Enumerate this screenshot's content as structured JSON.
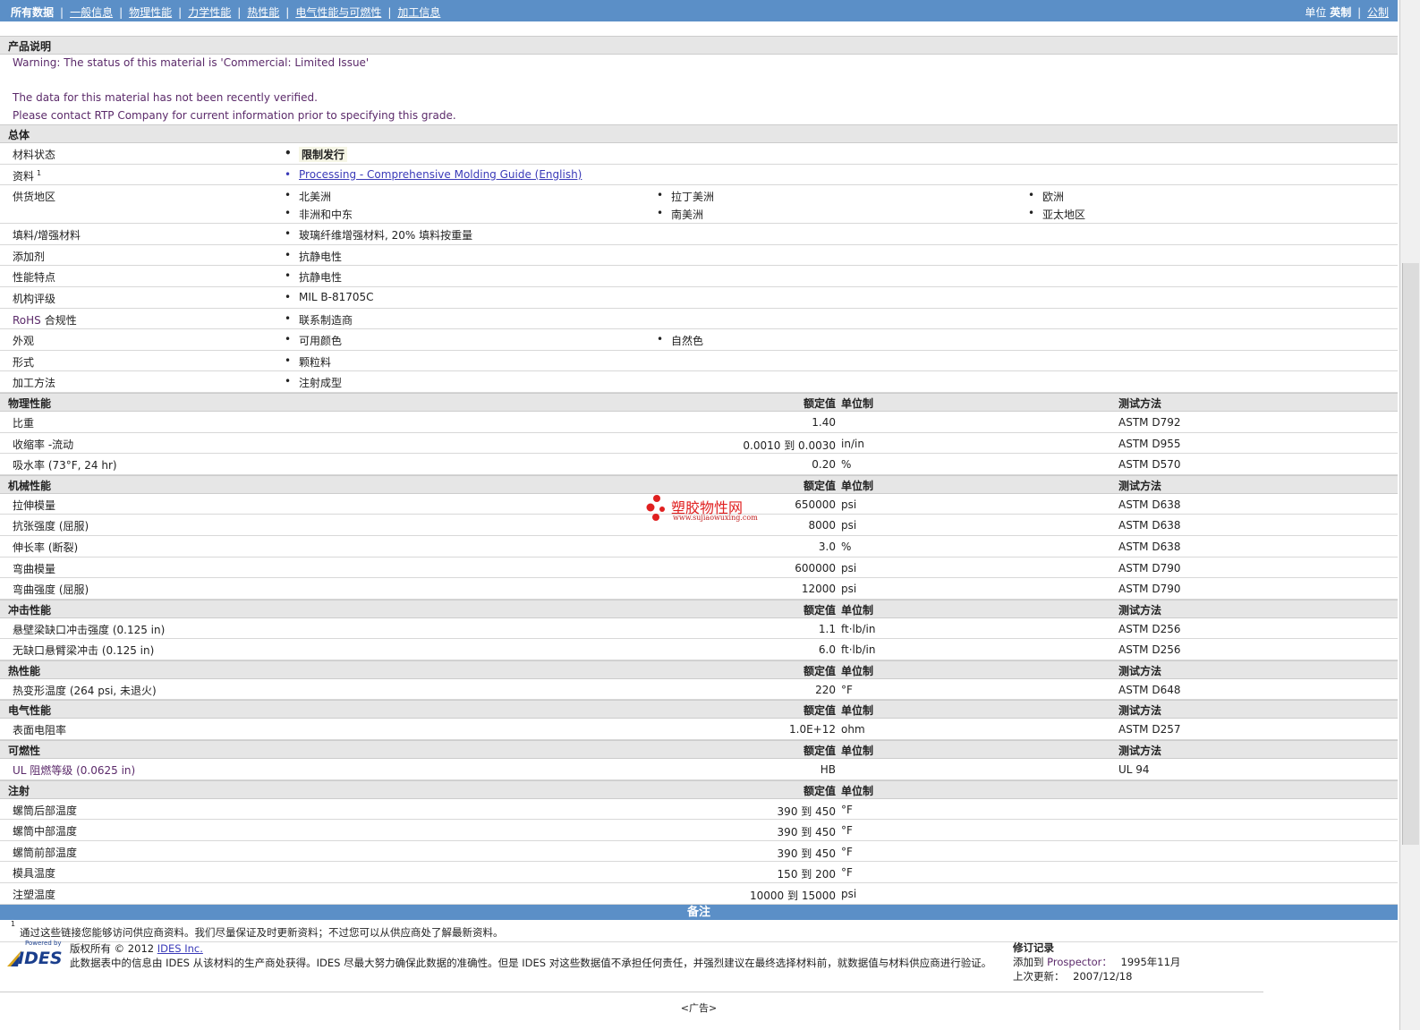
{
  "nav": {
    "items": [
      "所有数据",
      "一般信息",
      "物理性能",
      "力学性能",
      "热性能",
      "电气性能与可燃性",
      "加工信息"
    ],
    "sep": "|"
  },
  "units": {
    "label": "单位",
    "english": "英制",
    "sep": "|",
    "metric": "公制"
  },
  "product": {
    "title": "产品说明",
    "lines": [
      "Warning: The status of this material is 'Commercial: Limited Issue'",
      "",
      "The data for this material has not been recently verified.",
      "Please contact RTP Company for current information prior to specifying this grade."
    ]
  },
  "general": {
    "title": "总体",
    "rows": [
      {
        "label": "材料状态",
        "items": [
          "限制发行"
        ]
      },
      {
        "label": "资料",
        "sup": "1",
        "items": [
          "Processing - Comprehensive Molding Guide (English)"
        ]
      },
      {
        "label": "供货地区",
        "items": [
          "北美洲",
          "拉丁美洲",
          "欧洲",
          "非洲和中东",
          "南美洲",
          "亚太地区"
        ]
      },
      {
        "label": "填料/增强材料",
        "items": [
          "玻璃纤维增强材料, 20% 填料按重量"
        ]
      },
      {
        "label": "添加剂",
        "items": [
          "抗静电性"
        ]
      },
      {
        "label": "性能特点",
        "items": [
          "抗静电性"
        ]
      },
      {
        "label": "机构评级",
        "items": [
          "MIL B-81705C"
        ]
      },
      {
        "label_a": "RoHS",
        "label_b": "合规性",
        "items": [
          "联系制造商"
        ]
      },
      {
        "label": "外观",
        "items": [
          "可用颜色",
          "自然色"
        ]
      },
      {
        "label": "形式",
        "items": [
          "颗粒料"
        ]
      },
      {
        "label": "加工方法",
        "items": [
          "注射成型"
        ]
      }
    ]
  },
  "col_headers": {
    "value": "额定值",
    "unit": "单位制",
    "method": "测试方法"
  },
  "sections": [
    {
      "title": "物理性能",
      "has_method": true,
      "rows": [
        {
          "label": "比重",
          "value": "1.40",
          "unit": "",
          "method": "ASTM D792"
        },
        {
          "label": "收缩率 -流动",
          "value": "0.0010 到 0.0030",
          "unit": "in/in",
          "method": "ASTM D955"
        },
        {
          "label": "吸水率 (73°F, 24 hr)",
          "value": "0.20",
          "unit": "%",
          "method": "ASTM D570"
        }
      ]
    },
    {
      "title": "机械性能",
      "has_method": true,
      "rows": [
        {
          "label": "拉伸模量",
          "value": "650000",
          "unit": "psi",
          "method": "ASTM D638"
        },
        {
          "label": "抗张强度 (屈服)",
          "value": "8000",
          "unit": "psi",
          "method": "ASTM D638"
        },
        {
          "label": "伸长率 (断裂)",
          "value": "3.0",
          "unit": "%",
          "method": "ASTM D638"
        },
        {
          "label": "弯曲模量",
          "value": "600000",
          "unit": "psi",
          "method": "ASTM D790"
        },
        {
          "label": "弯曲强度 (屈服)",
          "value": "12000",
          "unit": "psi",
          "method": "ASTM D790"
        }
      ]
    },
    {
      "title": "冲击性能",
      "has_method": true,
      "rows": [
        {
          "label": "悬壁梁缺口冲击强度 (0.125 in)",
          "value": "1.1",
          "unit": "ft·lb/in",
          "method": "ASTM D256"
        },
        {
          "label": "无缺口悬臂梁冲击 (0.125 in)",
          "value": "6.0",
          "unit": "ft·lb/in",
          "method": "ASTM D256"
        }
      ]
    },
    {
      "title": "热性能",
      "has_method": true,
      "rows": [
        {
          "label": "热变形温度 (264 psi, 未退火)",
          "value": "220",
          "unit": "°F",
          "method": "ASTM D648"
        }
      ]
    },
    {
      "title": "电气性能",
      "has_method": true,
      "rows": [
        {
          "label": "表面电阻率",
          "value": "1.0E+12",
          "unit": "ohm",
          "method": "ASTM D257"
        }
      ]
    },
    {
      "title": "可燃性",
      "has_method": true,
      "rows": [
        {
          "label": "UL 阻燃等级 (0.0625 in)",
          "value": "HB",
          "unit": "",
          "method": "UL 94"
        }
      ]
    },
    {
      "title": "注射",
      "has_method": false,
      "rows": [
        {
          "label": "螺筒后部温度",
          "value": "390 到 450",
          "unit": "°F",
          "method": ""
        },
        {
          "label": "螺筒中部温度",
          "value": "390 到 450",
          "unit": "°F",
          "method": ""
        },
        {
          "label": "螺筒前部温度",
          "value": "390 到 450",
          "unit": "°F",
          "method": ""
        },
        {
          "label": "模具温度",
          "value": "150 到 200",
          "unit": "°F",
          "method": ""
        },
        {
          "label": "注塑温度",
          "value": "10000 到 15000",
          "unit": "psi",
          "method": ""
        }
      ]
    }
  ],
  "watermark": {
    "main": "塑胶物性网",
    "sub": "www.sujiaowuxing.com"
  },
  "notes": {
    "title": "备注",
    "sup": "1",
    "text": "通过这些链接您能够访问供应商资料。我们尽量保证及时更新资料；不过您可以从供应商处了解最新资料。"
  },
  "footer": {
    "powered": "Powered by",
    "logo": "IDES",
    "copyright": "版权所有 © 2012",
    "company": "IDES Inc.",
    "disclaimer": "此数据表中的信息由 IDES 从该材料的生产商处获得。IDES 尽最大努力确保此数据的准确性。但是 IDES 对这些数据值不承担任何责任，并强烈建议在最终选择材料前，就数据值与材料供应商进行验证。",
    "rev_title": "修订记录",
    "added_label": "添加到",
    "added_target": "Prospector：",
    "added_date": "1995年11月",
    "updated_label": "上次更新：",
    "updated_date": "2007/12/18"
  },
  "ad": "<广告>"
}
